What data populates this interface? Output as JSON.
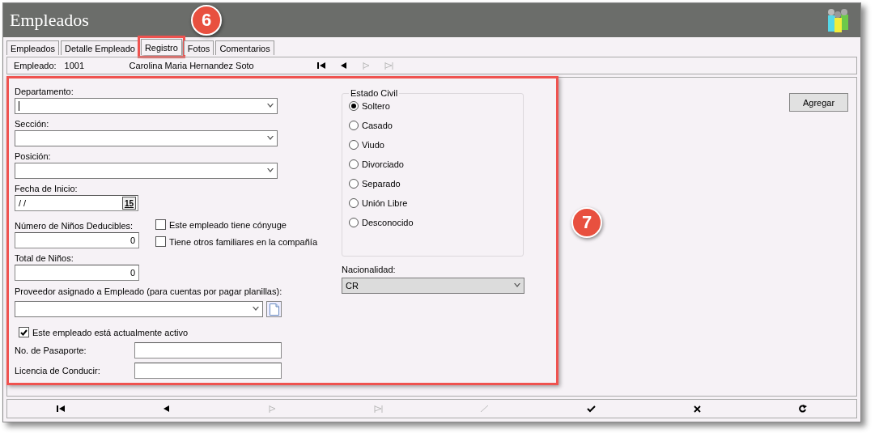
{
  "window": {
    "title": "Empleados"
  },
  "tabs": [
    {
      "label": "Empleados",
      "selected": false,
      "highlighted": false
    },
    {
      "label": "Detalle Empleado",
      "selected": false,
      "highlighted": false
    },
    {
      "label": "Registro",
      "selected": true,
      "highlighted": true
    },
    {
      "label": "Fotos",
      "selected": false,
      "highlighted": false
    },
    {
      "label": "Comentarios",
      "selected": false,
      "highlighted": false
    }
  ],
  "employee": {
    "label": "Empleado:",
    "number": "1001",
    "name": "Carolina Maria Hernandez Soto"
  },
  "record_nav": [
    {
      "kind": "first",
      "disabled": false
    },
    {
      "kind": "prev",
      "disabled": false
    },
    {
      "kind": "next",
      "disabled": true
    },
    {
      "kind": "last",
      "disabled": true
    }
  ],
  "form": {
    "highlighted": true,
    "departamento": {
      "label": "Departamento:"
    },
    "seccion": {
      "label": "Sección:"
    },
    "posicion": {
      "label": "Posición:"
    },
    "fecha_inicio": {
      "label": "Fecha de Inicio:",
      "value": " /  /",
      "calendar": "15"
    },
    "ninos_deducibles": {
      "label": "Número de Niños Deducibles:",
      "value": "0"
    },
    "total_ninos": {
      "label": "Total de Niños:",
      "value": "0"
    },
    "checks": [
      {
        "label": "Este empleado tiene cónyuge",
        "checked": false
      },
      {
        "label": "Tiene otros familiares en la compañía",
        "checked": false
      }
    ],
    "proveedor": {
      "label": "Proveedor asignado a Empleado (para cuentas por pagar planillas):"
    },
    "activo": {
      "label": "Este empleado está actualmente activo",
      "checked": true
    },
    "pasaporte": {
      "label": "No. de Pasaporte:"
    },
    "licencia": {
      "label": "Licencia de Conducir:"
    },
    "estado_civil": {
      "title": "Estado Civil",
      "options": [
        {
          "label": "Soltero",
          "selected": true
        },
        {
          "label": "Casado",
          "selected": false
        },
        {
          "label": "Viudo",
          "selected": false
        },
        {
          "label": "Divorciado",
          "selected": false
        },
        {
          "label": "Separado",
          "selected": false
        },
        {
          "label": "Unión Libre",
          "selected": false
        },
        {
          "label": "Desconocido",
          "selected": false
        }
      ]
    },
    "nacionalidad": {
      "label": "Nacionalidad:",
      "value": "CR"
    }
  },
  "agregar_button": "Agregar",
  "bottom_nav": [
    {
      "kind": "first",
      "disabled": false
    },
    {
      "kind": "prev",
      "disabled": false
    },
    {
      "kind": "next",
      "disabled": true
    },
    {
      "kind": "last",
      "disabled": true
    },
    {
      "kind": "edit",
      "disabled": true
    },
    {
      "kind": "save",
      "disabled": false
    },
    {
      "kind": "cancel",
      "disabled": false
    },
    {
      "kind": "refresh",
      "disabled": false
    }
  ],
  "callouts": [
    {
      "number": "6"
    },
    {
      "number": "7"
    }
  ]
}
